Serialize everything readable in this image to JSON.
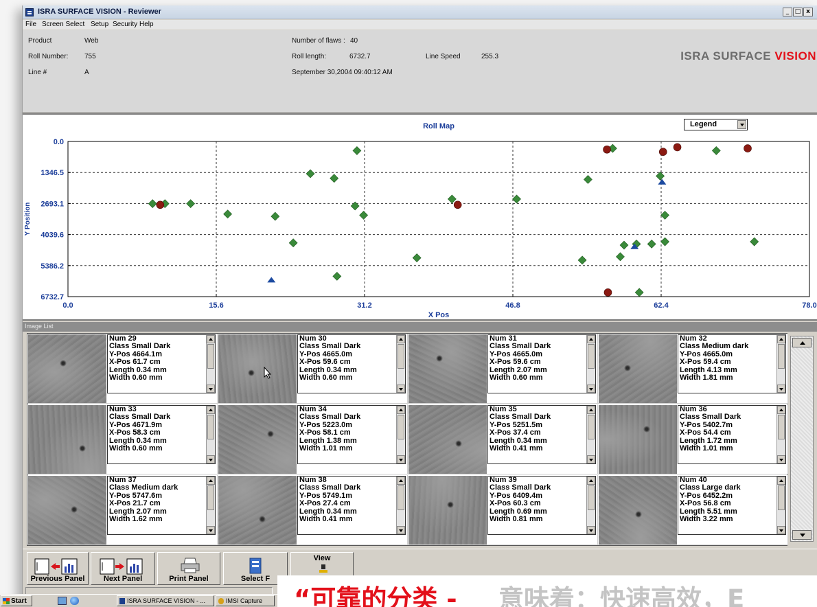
{
  "window": {
    "title": "ISRA SURFACE VISION - Reviewer",
    "controls": {
      "minimize": "_",
      "maximize": "□",
      "close": "x"
    }
  },
  "menu": [
    "File",
    "Screen Select",
    "Setup",
    "Security",
    "Help"
  ],
  "info": {
    "product_label": "Product",
    "product_value": "Web",
    "roll_label": "Roll Number:",
    "roll_value": "755",
    "line_label": "Line #",
    "line_value": "A",
    "flaws_label": "Number of flaws :",
    "flaws_value": "40",
    "length_label": "Roll length:",
    "length_value": "6732.7",
    "speed_label": "Line Speed",
    "speed_value": "255.3",
    "date": "September 30,2004  09:40:12 AM"
  },
  "brand": {
    "main": "ISRA SURFACE ",
    "accent": "VISION"
  },
  "legend_select": {
    "value": "Legend"
  },
  "chart_data": {
    "type": "scatter",
    "title": "Roll Map",
    "xlabel": "X Pos",
    "ylabel": "Y Position",
    "xlim": [
      0,
      78
    ],
    "ylim": [
      0,
      6732.7
    ],
    "y_inverted": true,
    "x_ticks": [
      "0.0",
      "15.6",
      "31.2",
      "46.8",
      "62.4",
      "78.0"
    ],
    "y_ticks": [
      "0.0",
      "1346.5",
      "2693.1",
      "4039.6",
      "5386.2",
      "6732.7"
    ],
    "grid": true,
    "series": [
      {
        "marker": "diamond",
        "color": "#3a8a3a",
        "points": [
          [
            8.9,
            2700
          ],
          [
            10.2,
            2700
          ],
          [
            12.9,
            2700
          ],
          [
            16.8,
            3150
          ],
          [
            21.8,
            3250
          ],
          [
            23.7,
            4400
          ],
          [
            25.5,
            1400
          ],
          [
            28.0,
            1600
          ],
          [
            28.3,
            5850
          ],
          [
            30.2,
            2800
          ],
          [
            30.4,
            400
          ],
          [
            31.1,
            3200
          ],
          [
            36.7,
            5050
          ],
          [
            40.4,
            2500
          ],
          [
            47.2,
            2500
          ],
          [
            54.1,
            5150
          ],
          [
            54.7,
            1650
          ],
          [
            57.3,
            300
          ],
          [
            58.1,
            5000
          ],
          [
            58.5,
            4500
          ],
          [
            59.8,
            4450
          ],
          [
            60.1,
            6550
          ],
          [
            61.4,
            4450
          ],
          [
            62.3,
            1500
          ],
          [
            62.8,
            3200
          ],
          [
            62.8,
            4350
          ],
          [
            68.2,
            400
          ],
          [
            72.2,
            4350
          ]
        ],
        "colors": []
      },
      {
        "marker": "circle",
        "color": "#8b1a12",
        "points": [
          [
            9.7,
            2750
          ],
          [
            41.0,
            2750
          ],
          [
            56.7,
            350
          ],
          [
            56.8,
            6550
          ],
          [
            62.6,
            450
          ],
          [
            64.1,
            250
          ],
          [
            71.5,
            300
          ]
        ]
      },
      {
        "marker": "triangle",
        "color": "#1c4aa0",
        "points": [
          [
            21.4,
            6000
          ],
          [
            59.6,
            4550
          ],
          [
            62.5,
            1750
          ]
        ]
      }
    ]
  },
  "image_list": {
    "label": "Image List",
    "items": [
      {
        "num": "Num 29",
        "cls": "Class Small Dark",
        "ypos": "Y-Pos 4664.1m",
        "xpos": "X-Pos 61.7 cm",
        "len": "Length 0.34 mm",
        "wid": "Width 0.60 mm"
      },
      {
        "num": "Num 30",
        "cls": "Class Small Dark",
        "ypos": "Y-Pos 4665.0m",
        "xpos": "X-Pos 59.6 cm",
        "len": "Length 0.34 mm",
        "wid": "Width 0.60 mm"
      },
      {
        "num": "Num 31",
        "cls": "Class Small Dark",
        "ypos": "Y-Pos 4665.0m",
        "xpos": "X-Pos 59.6 cm",
        "len": "Length 2.07 mm",
        "wid": "Width 0.60 mm"
      },
      {
        "num": "Num 32",
        "cls": "Class Medium dark",
        "ypos": "Y-Pos 4665.0m",
        "xpos": "X-Pos 59.4 cm",
        "len": "Length 4.13 mm",
        "wid": "Width 1.81 mm"
      },
      {
        "num": "Num 33",
        "cls": "Class Small Dark",
        "ypos": "Y-Pos 4671.9m",
        "xpos": "X-Pos 58.3 cm",
        "len": "Length 0.34 mm",
        "wid": "Width 0.60 mm"
      },
      {
        "num": "Num 34",
        "cls": "Class Small Dark",
        "ypos": "Y-Pos 5223.0m",
        "xpos": "X-Pos 58.1 cm",
        "len": "Length 1.38 mm",
        "wid": "Width 1.01 mm"
      },
      {
        "num": "Num 35",
        "cls": "Class Small Dark",
        "ypos": "Y-Pos 5251.5m",
        "xpos": "X-Pos 37.4 cm",
        "len": "Length 0.34 mm",
        "wid": "Width 0.41 mm"
      },
      {
        "num": "Num 36",
        "cls": "Class Small Dark",
        "ypos": "Y-Pos 5402.7m",
        "xpos": "X-Pos 54.4 cm",
        "len": "Length 1.72 mm",
        "wid": "Width 1.01 mm"
      },
      {
        "num": "Num 37",
        "cls": "Class Medium dark",
        "ypos": "Y-Pos 5747.6m",
        "xpos": "X-Pos 21.7 cm",
        "len": "Length 2.07 mm",
        "wid": "Width 1.62 mm"
      },
      {
        "num": "Num 38",
        "cls": "Class Small Dark",
        "ypos": "Y-Pos 5749.1m",
        "xpos": "X-Pos 27.4 cm",
        "len": "Length 0.34 mm",
        "wid": "Width 0.41 mm"
      },
      {
        "num": "Num 39",
        "cls": "Class Small Dark",
        "ypos": "Y-Pos 6409.4m",
        "xpos": "X-Pos 60.3 cm",
        "len": "Length 0.69 mm",
        "wid": "Width 0.81 mm"
      },
      {
        "num": "Num 40",
        "cls": "Class Large dark",
        "ypos": "Y-Pos 6452.2m",
        "xpos": "X-Pos 56.8 cm",
        "len": "Length 5.51 mm",
        "wid": "Width 3.22 mm"
      }
    ]
  },
  "toolbar": {
    "prev": "Previous Panel",
    "next": "Next Panel",
    "print": "Print Panel",
    "select": "Select F",
    "view": "View"
  },
  "taskbar": {
    "start": "Start",
    "task1": "ISRA SURFACE VISION - ...",
    "task2": "IMSI Capture"
  },
  "caption": {
    "red": "“可靠的分类 -",
    "gray": "意味着：快速高效，E"
  }
}
